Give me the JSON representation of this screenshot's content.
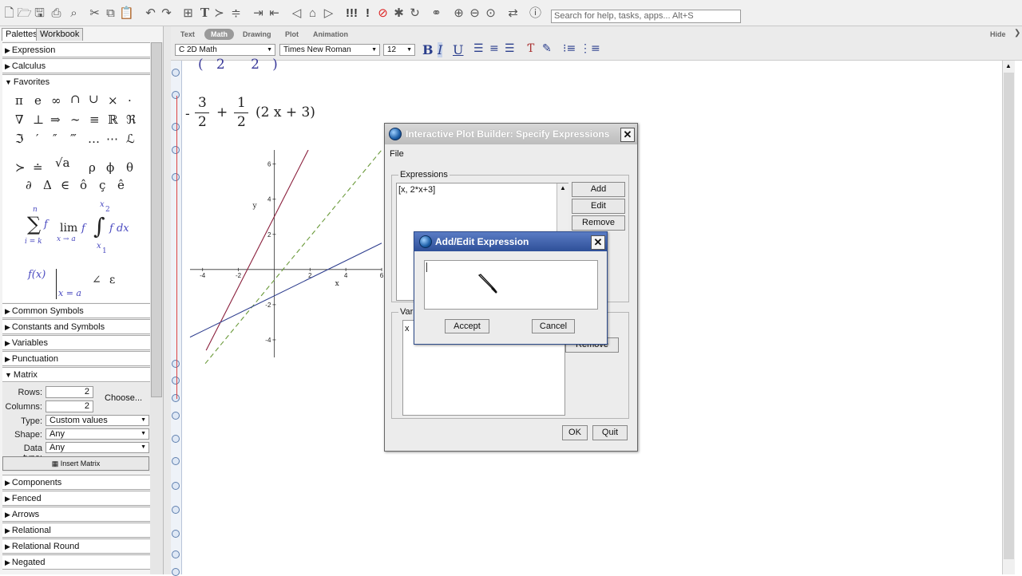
{
  "toolbar": {
    "search_placeholder": "Search for help, tasks, apps... Alt+S",
    "icons": [
      "new-icon",
      "open-icon",
      "save-icon",
      "print-icon",
      "preview-icon",
      "cut-icon",
      "copy-icon",
      "paste-icon",
      "undo-icon",
      "redo-icon",
      "insert-icon",
      "text-icon",
      "prompt-icon",
      "section-icon",
      "indent-icon",
      "outdent-icon",
      "back-icon",
      "home-icon",
      "forward-icon",
      "execute-all-icon",
      "execute-icon",
      "stop-icon",
      "debug-icon",
      "restart-icon",
      "link-icon",
      "zoom-100-icon",
      "zoom-150-icon",
      "zoom-200-icon",
      "swap-icon",
      "help-icon"
    ]
  },
  "left_panel": {
    "tabs": [
      "Palettes",
      "Workbook"
    ],
    "sections_top": [
      {
        "label": "Expression",
        "expanded": false
      },
      {
        "label": "Calculus",
        "expanded": false
      },
      {
        "label": "Favorites",
        "expanded": true
      }
    ],
    "favorites_symbols": {
      "row1": [
        "π",
        "e",
        "∞",
        "∩",
        "∪",
        "×",
        "·"
      ],
      "row2": [
        "∇",
        "⊥",
        "⇒",
        "∼",
        "≡",
        "ℝ",
        "ℜ"
      ],
      "row3": [
        "ℑ",
        "′",
        "″",
        "‴",
        "…",
        "⋯",
        "ℒ"
      ],
      "row4": [
        "≻",
        "≐",
        "√a",
        "ρ",
        "ϕ",
        "θ"
      ],
      "row5": [
        "∂",
        "Δ",
        "∈",
        "ô",
        "ç",
        "ê"
      ]
    },
    "favorites_templates": {
      "sum_upper": "n",
      "sum_lower": "i = k",
      "sum_body": "f",
      "lim_word": "lim",
      "lim_body": "f",
      "lim_sub": "x → a",
      "int_upper": "x",
      "int_upper_sub": "2",
      "int_lower": "x",
      "int_lower_sub": "1",
      "int_body": "f dx",
      "eval_expr": "f(x)",
      "eval_sub": "x = a",
      "angle": "∠",
      "epsilon": "ε"
    },
    "sections_mid": [
      {
        "label": "Common Symbols",
        "expanded": false
      },
      {
        "label": "Constants and Symbols",
        "expanded": false
      },
      {
        "label": "Variables",
        "expanded": false
      },
      {
        "label": "Punctuation",
        "expanded": false
      },
      {
        "label": "Matrix",
        "expanded": true
      }
    ],
    "matrix": {
      "rows_label": "Rows:",
      "rows_value": "2",
      "columns_label": "Columns:",
      "columns_value": "2",
      "choose_label": "Choose...",
      "type_label": "Type:",
      "type_value": "Custom values",
      "shape_label": "Shape:",
      "shape_value": "Any",
      "datatype_label": "Data type:",
      "datatype_value": "Any",
      "insert_label": "Insert Matrix"
    },
    "sections_bottom": [
      {
        "label": "Components",
        "expanded": false
      },
      {
        "label": "Fenced",
        "expanded": false
      },
      {
        "label": "Arrows",
        "expanded": false
      },
      {
        "label": "Relational",
        "expanded": false
      },
      {
        "label": "Relational Round",
        "expanded": false
      },
      {
        "label": "Negated",
        "expanded": false
      }
    ]
  },
  "context_bar": {
    "tabs": [
      "Text",
      "Math",
      "Drawing",
      "Plot",
      "Animation"
    ],
    "active_tab": "Math",
    "hide_label": "Hide",
    "mode_value": "C  2D Math",
    "font_value": "Times New Roman",
    "size_value": "12"
  },
  "document": {
    "top_fragment": "(   2      2   )",
    "expression": {
      "neg": "-",
      "frac1_num": "3",
      "frac1_den": "2",
      "plus": "+",
      "frac2_num": "1",
      "frac2_den": "2",
      "tail": "(2 x + 3)"
    }
  },
  "chart_data": {
    "type": "line",
    "title": "",
    "xlabel": "x",
    "ylabel": "y",
    "xlim": [
      -4.7,
      6.0
    ],
    "ylim": [
      -5.0,
      6.8
    ],
    "x_ticks": [
      "-4",
      "-2",
      "2",
      "4",
      "6"
    ],
    "y_ticks": [
      "6",
      "4",
      "2",
      "-2",
      "-4"
    ],
    "series": [
      {
        "style": "solid",
        "color": "#8a1f3c",
        "points": [
          [
            -3.8,
            -4.6
          ],
          [
            1.9,
            6.8
          ]
        ]
      },
      {
        "style": "dashed",
        "color": "#6a9a3a",
        "points": [
          [
            -4.7,
            -6.4
          ],
          [
            6.0,
            6.8
          ]
        ]
      },
      {
        "style": "solid",
        "color": "#2f3f8f",
        "points": [
          [
            -4.7,
            -3.85
          ],
          [
            6.0,
            1.5
          ]
        ]
      }
    ]
  },
  "plot_builder": {
    "title": "Interactive Plot Builder: Specify Expressions",
    "menu_file": "File",
    "expressions_label": "Expressions",
    "expression_item": "[x, 2*x+3]",
    "add_label": "Add",
    "edit_label": "Edit",
    "remove_label": "Remove",
    "variables_label": "Vari",
    "variable_item": "x",
    "remove2_label": "Remove",
    "ok_label": "OK",
    "quit_label": "Quit"
  },
  "add_edit": {
    "title": "Add/Edit Expression",
    "input_value": "",
    "accept_label": "Accept",
    "cancel_label": "Cancel"
  }
}
